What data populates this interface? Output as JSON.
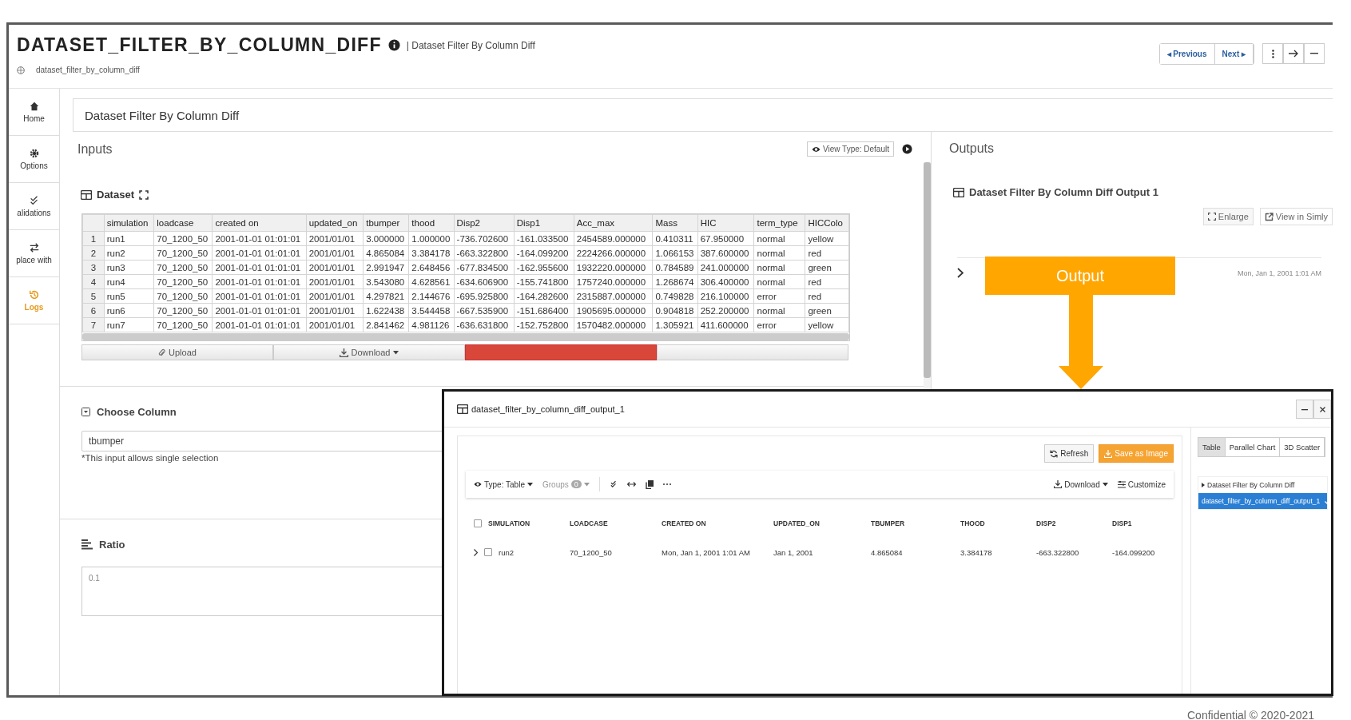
{
  "header": {
    "title": "DATASET_FILTER_BY_COLUMN_DIFF",
    "subtitle": "| Dataset Filter By Column Diff",
    "breadcrumb": "dataset_filter_by_column_diff",
    "nav": [
      "◂ Previous",
      "Next ▸"
    ]
  },
  "sidebar": [
    {
      "label": "Home",
      "kind": "home",
      "selected": false
    },
    {
      "label": "Options",
      "kind": "gear",
      "selected": false
    },
    {
      "label": "alidations",
      "kind": "checks",
      "selected": false
    },
    {
      "label": "place with",
      "kind": "swap",
      "selected": false
    },
    {
      "label": "Logs",
      "kind": "history",
      "selected": true
    }
  ],
  "page_title": "Dataset Filter By Column Diff",
  "inputs": {
    "title": "Inputs",
    "view_type": "View Type: Default",
    "dataset": {
      "title": "Dataset",
      "columns": [
        "simulation",
        "loadcase",
        "created on",
        "updated_on",
        "tbumper",
        "thood",
        "Disp2",
        "Disp1",
        "Acc_max",
        "Mass",
        "HIC",
        "term_type",
        "HICColo"
      ],
      "rows": [
        {
          "index": "1",
          "cells": [
            "run1",
            "70_1200_50",
            "2001-01-01 01:01:01",
            "2001/01/01",
            "3.000000",
            "1.000000",
            "-736.702600",
            "-161.033500",
            "2454589.000000",
            "0.410311",
            "67.950000",
            "normal",
            "yellow"
          ]
        },
        {
          "index": "2",
          "cells": [
            "run2",
            "70_1200_50",
            "2001-01-01 01:01:01",
            "2001/01/01",
            "4.865084",
            "3.384178",
            "-663.322800",
            "-164.099200",
            "2224266.000000",
            "1.066153",
            "387.600000",
            "normal",
            "red"
          ]
        },
        {
          "index": "3",
          "cells": [
            "run3",
            "70_1200_50",
            "2001-01-01 01:01:01",
            "2001/01/01",
            "2.991947",
            "2.648456",
            "-677.834500",
            "-162.955600",
            "1932220.000000",
            "0.784589",
            "241.000000",
            "normal",
            "green"
          ]
        },
        {
          "index": "4",
          "cells": [
            "run4",
            "70_1200_50",
            "2001-01-01 01:01:01",
            "2001/01/01",
            "3.543080",
            "4.628561",
            "-634.606900",
            "-155.741800",
            "1757240.000000",
            "1.268674",
            "306.400000",
            "normal",
            "red"
          ]
        },
        {
          "index": "5",
          "cells": [
            "run5",
            "70_1200_50",
            "2001-01-01 01:01:01",
            "2001/01/01",
            "4.297821",
            "2.144676",
            "-695.925800",
            "-164.282600",
            "2315887.000000",
            "0.749828",
            "216.100000",
            "error",
            "red"
          ]
        },
        {
          "index": "6",
          "cells": [
            "run6",
            "70_1200_50",
            "2001-01-01 01:01:01",
            "2001/01/01",
            "1.622438",
            "3.544458",
            "-667.535900",
            "-151.686400",
            "1905695.000000",
            "0.904818",
            "252.200000",
            "normal",
            "green"
          ]
        },
        {
          "index": "7",
          "cells": [
            "run7",
            "70_1200_50",
            "2001-01-01 01:01:01",
            "2001/01/01",
            "2.841462",
            "4.981126",
            "-636.631800",
            "-152.752800",
            "1570482.000000",
            "1.305921",
            "411.600000",
            "error",
            "yellow"
          ]
        }
      ]
    },
    "actions": [
      {
        "label": "Upload",
        "kind": "upload"
      },
      {
        "label": "Download",
        "kind": "download"
      },
      {
        "kind": "danger"
      },
      {
        "kind": "plain"
      }
    ],
    "choose_column": {
      "title": "Choose Column",
      "value": "tbumper",
      "hint": "*This input allows single selection"
    },
    "ratio": {
      "title": "Ratio",
      "placeholder": "0.1"
    }
  },
  "outputs": {
    "title": "Outputs",
    "output_title": "Dataset Filter By Column Diff Output 1",
    "buttons": [
      {
        "label": "Enlarge",
        "kind": "enlarge"
      },
      {
        "label": "View in Simly",
        "kind": "external"
      }
    ],
    "row_date": "Mon, Jan 1, 2001 1:01 AM"
  },
  "callout": {
    "label": "Output"
  },
  "popup": {
    "title": "dataset_filter_by_column_diff_output_1",
    "actions": [
      {
        "label": "Refresh",
        "kind": "refresh"
      },
      {
        "label": "Save as Image",
        "kind": "save"
      }
    ],
    "type_label": "Type: Table",
    "groups_label": "Groups",
    "groups_count": "0",
    "download": "Download",
    "customize": "Customize",
    "columns": [
      "SIMULATION",
      "LOADCASE",
      "CREATED ON",
      "UPDATED_ON",
      "TBUMPER",
      "THOOD",
      "DISP2",
      "DISP1"
    ],
    "all_checked": false,
    "rows": [
      {
        "checked": false,
        "cells": [
          "run2",
          "70_1200_50",
          "Mon, Jan 1, 2001 1:01 AM",
          "Jan 1, 2001",
          "4.865084",
          "3.384178",
          "-663.322800",
          "-164.099200"
        ]
      }
    ],
    "view_tabs": [
      {
        "label": "Table",
        "selected": true
      },
      {
        "label": "Parallel Chart",
        "selected": false
      },
      {
        "label": "3D Scatter",
        "selected": false
      }
    ],
    "tree": [
      {
        "label": "Dataset Filter By Column Diff",
        "selected": false,
        "children": [
          {
            "label": "dataset_filter_by_column_diff_output_1",
            "selected": true
          }
        ]
      }
    ]
  },
  "footer": "Confidential © 2020-2021"
}
